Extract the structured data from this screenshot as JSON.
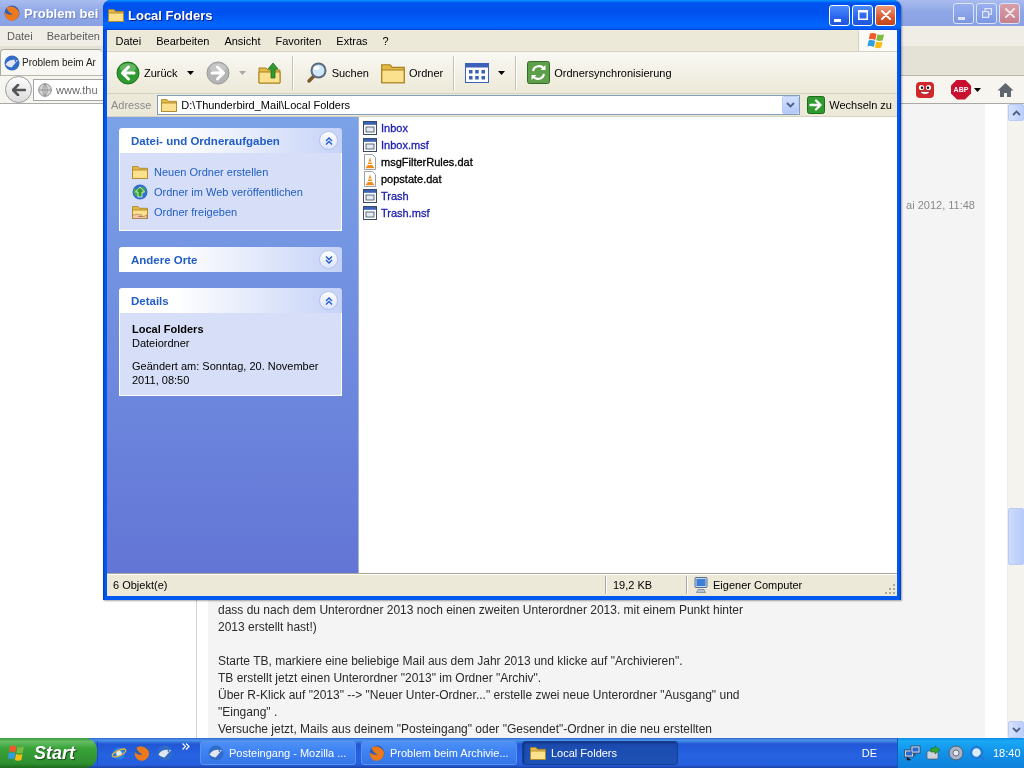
{
  "browser": {
    "title": "Problem bei",
    "menu": [
      "Datei",
      "Bearbeiten"
    ],
    "tabs": [
      {
        "label": "Problem beim Ar",
        "selected": true
      }
    ],
    "url": "www.thu",
    "toolbar_buttons": [
      {
        "kind": "face"
      },
      {
        "kind": "adblock",
        "label": "ABP",
        "dropdown": true
      },
      {
        "kind": "home"
      }
    ],
    "post": {
      "date": "ai 2012, 11:48",
      "paragraphs": [
        [
          "dass du nach dem Unterordner 2013 noch einen zweiten Unterordner 2013. mit einem Punkt hinter",
          "2013 erstellt hast!)"
        ],
        [
          "Starte TB, markiere eine beliebige Mail aus dem Jahr 2013 und klicke auf \"Archivieren\".",
          "TB erstellt jetzt einen Unterordner \"2013\" im Ordner \"Archiv\".",
          "Über R-Klick auf \"2013\" --> \"Neuer Unter-Ordner...\" erstelle zwei neue Unterordner \"Ausgang\" und",
          "\"Eingang\" .",
          "Versuche jetzt, Mails aus deinem \"Posteingang\" oder \"Gesendet\"-Ordner in die neu erstellten"
        ]
      ]
    }
  },
  "explorer": {
    "title": "Local Folders",
    "menu": [
      "Datei",
      "Bearbeiten",
      "Ansicht",
      "Favoriten",
      "Extras",
      "?"
    ],
    "toolbar": [
      {
        "kind": "back",
        "label": "Zurück",
        "dropdown": true,
        "disabled": false
      },
      {
        "kind": "forward",
        "dropdown": true,
        "disabled": true
      },
      {
        "kind": "up"
      },
      {
        "kind": "separator"
      },
      {
        "kind": "search",
        "label": "Suchen"
      },
      {
        "kind": "folders",
        "label": "Ordner"
      },
      {
        "kind": "separator"
      },
      {
        "kind": "views",
        "dropdown": true
      },
      {
        "kind": "separator"
      },
      {
        "kind": "sync",
        "label": "Ordnersynchronisierung"
      }
    ],
    "address": {
      "label": "Adresse",
      "value": "D:\\Thunderbird_Mail\\Local Folders",
      "go_button": "Wechseln zu"
    },
    "task_panels": [
      {
        "kind": "tasks",
        "title": "Datei- und Ordneraufgaben",
        "expanded": true,
        "items": [
          {
            "kind": "new-folder",
            "label": "Neuen Ordner erstellen"
          },
          {
            "kind": "publish",
            "label": "Ordner im Web veröffentlichen"
          },
          {
            "kind": "share",
            "label": "Ordner freigeben"
          }
        ]
      },
      {
        "title": "Andere Orte",
        "expanded": false
      },
      {
        "kind": "details",
        "title": "Details",
        "expanded": true,
        "name": "Local Folders",
        "type": "Dateiordner",
        "modified": "Geändert am: Sonntag, 20. November 2011, 08:50"
      }
    ],
    "files": [
      {
        "name": "Inbox",
        "kind": "file",
        "color": "#1c1cb0"
      },
      {
        "name": "Inbox.msf",
        "kind": "file",
        "color": "#1c1cb0"
      },
      {
        "name": "msgFilterRules.dat",
        "kind": "media",
        "color": "#000000"
      },
      {
        "name": "popstate.dat",
        "kind": "media",
        "color": "#000000"
      },
      {
        "name": "Trash",
        "kind": "file",
        "color": "#1c1cb0"
      },
      {
        "name": "Trash.msf",
        "kind": "file",
        "color": "#1c1cb0"
      }
    ],
    "status_bar": {
      "count": "6 Objekt(e)",
      "size": "19,2 KB",
      "location": "Eigener Computer"
    }
  },
  "taskbar": {
    "start": "Start",
    "quick_launch": [
      {
        "kind": "orbit"
      },
      {
        "kind": "fox"
      },
      {
        "kind": "bird"
      }
    ],
    "tasks": [
      {
        "kind": "bird",
        "label": "Posteingang - Mozilla ...",
        "selected": false
      },
      {
        "kind": "fox",
        "label": "Problem beim Archivie...",
        "selected": false
      },
      {
        "kind": "folder",
        "label": "Local Folders",
        "selected": true
      }
    ],
    "language": "DE",
    "clock": "18:40"
  }
}
